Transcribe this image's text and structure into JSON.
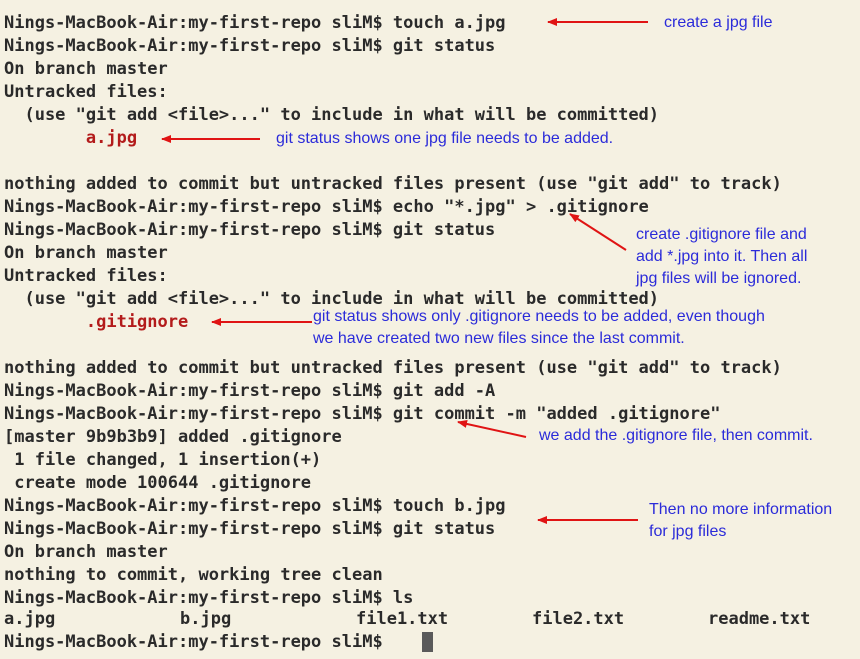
{
  "terminal": {
    "lines": [
      "Nings-MacBook-Air:my-first-repo sliM$ touch a.jpg",
      "Nings-MacBook-Air:my-first-repo sliM$ git status",
      "On branch master",
      "Untracked files:",
      "  (use \"git add <file>...\" to include in what will be committed)",
      "        a.jpg",
      "",
      "nothing added to commit but untracked files present (use \"git add\" to track)",
      "Nings-MacBook-Air:my-first-repo sliM$ echo \"*.jpg\" > .gitignore",
      "Nings-MacBook-Air:my-first-repo sliM$ git status",
      "On branch master",
      "Untracked files:",
      "  (use \"git add <file>...\" to include in what will be committed)",
      "        .gitignore",
      "",
      "nothing added to commit but untracked files present (use \"git add\" to track)",
      "Nings-MacBook-Air:my-first-repo sliM$ git add -A",
      "Nings-MacBook-Air:my-first-repo sliM$ git commit -m \"added .gitignore\"",
      "[master 9b9b3b9] added .gitignore",
      " 1 file changed, 1 insertion(+)",
      " create mode 100644 .gitignore",
      "Nings-MacBook-Air:my-first-repo sliM$ touch b.jpg",
      "Nings-MacBook-Air:my-first-repo sliM$ git status",
      "On branch master",
      "nothing to commit, working tree clean",
      "Nings-MacBook-Air:my-first-repo sliM$ ls",
      "",
      "Nings-MacBook-Air:my-first-repo sliM$ "
    ],
    "ls_output": [
      "a.jpg",
      "b.jpg",
      "file1.txt",
      "file2.txt",
      "readme.txt"
    ]
  },
  "annotations": {
    "create_jpg": "create a jpg file",
    "status_one_jpg": "git status shows one jpg file needs to be added.",
    "create_gitignore": "create .gitignore file and\nadd *.jpg into it. Then all\njpg files will be ignored.",
    "status_only_gitignore": "git status shows only .gitignore needs to be added, even though\nwe have created two new files since the last commit.",
    "add_commit": "we add the .gitignore file, then commit.",
    "no_more_info": "Then no more information\nfor jpg files"
  },
  "colors": {
    "background": "#f5f1e2",
    "text": "#2a2a2a",
    "untracked": "#b31b1b",
    "annotation": "#2b2bd9",
    "arrow": "#e01414"
  }
}
